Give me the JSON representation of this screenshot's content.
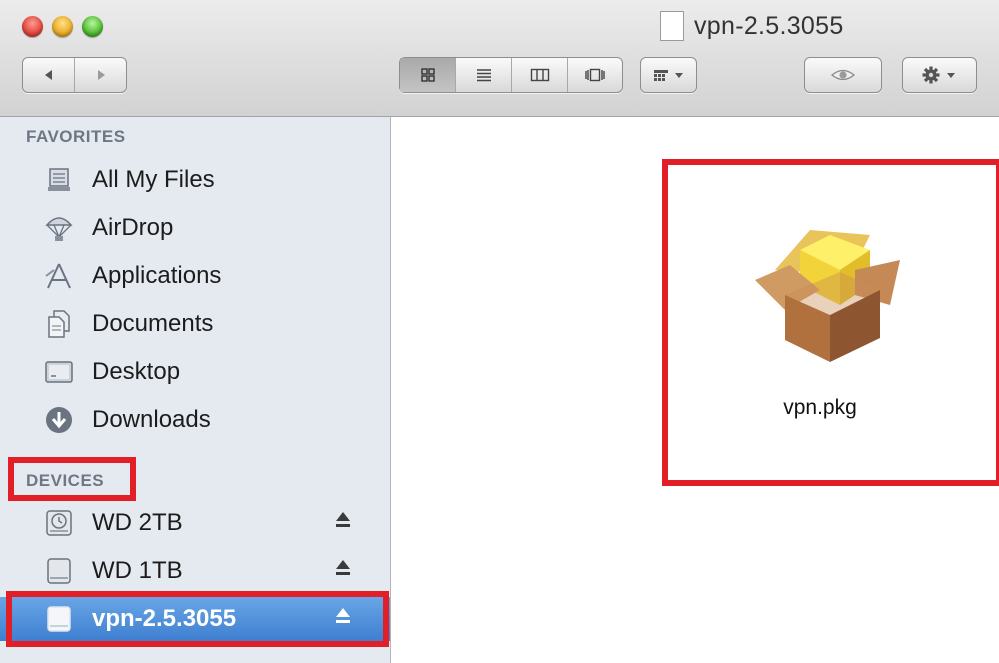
{
  "window": {
    "title": "vpn-2.5.3055"
  },
  "toolbar": {
    "back_icon": "back-arrow-icon",
    "forward_icon": "forward-arrow-icon",
    "view_buttons": [
      "icon-view-icon",
      "list-view-icon",
      "column-view-icon",
      "cover-flow-icon"
    ],
    "arrange_icon": "arrange-icon",
    "quicklook_icon": "eye-icon",
    "action_icon": "gear-icon"
  },
  "sidebar": {
    "favorites_header": "FAVORITES",
    "favorites": [
      {
        "label": "All My Files",
        "icon": "all-my-files-icon"
      },
      {
        "label": "AirDrop",
        "icon": "airdrop-icon"
      },
      {
        "label": "Applications",
        "icon": "applications-icon"
      },
      {
        "label": "Documents",
        "icon": "documents-icon"
      },
      {
        "label": "Desktop",
        "icon": "desktop-icon"
      },
      {
        "label": "Downloads",
        "icon": "downloads-icon"
      }
    ],
    "devices_header": "DEVICES",
    "devices": [
      {
        "label": "WD 2TB",
        "icon": "time-machine-disk-icon"
      },
      {
        "label": "WD 1TB",
        "icon": "disk-icon"
      },
      {
        "label": "vpn-2.5.3055",
        "icon": "disk-image-icon",
        "selected": true
      }
    ]
  },
  "content": {
    "files": [
      {
        "name": "vpn.pkg",
        "icon": "package-icon"
      }
    ]
  },
  "colors": {
    "highlight": "#e21f26",
    "selection": "#3e7fd1",
    "sidebar_bg": "#e5eaf1"
  }
}
